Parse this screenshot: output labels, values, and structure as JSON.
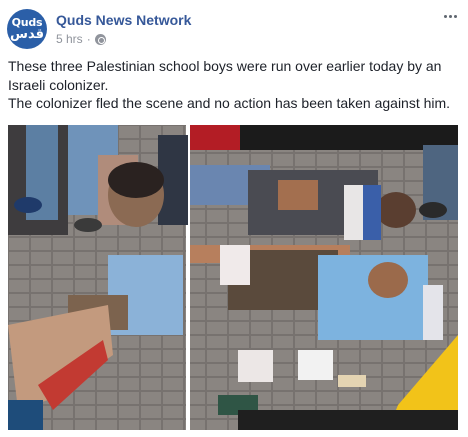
{
  "post": {
    "avatar": {
      "line1": "Quds",
      "line2": "قدس"
    },
    "page_name": "Quds News Network",
    "timestamp": "5 hrs",
    "separator": "·",
    "privacy_icon": "globe-icon",
    "more_icon": "more-options-icon",
    "text_lines": [
      "These three Palestinian school boys were run over earlier today by an Israeli colonizer.",
      "The colonizer fled the scene and no action has been taken against him."
    ]
  },
  "colors": {
    "link": "#365899",
    "meta": "#90949c",
    "text": "#1d2129",
    "avatar_bg": "#2b5fa8"
  }
}
